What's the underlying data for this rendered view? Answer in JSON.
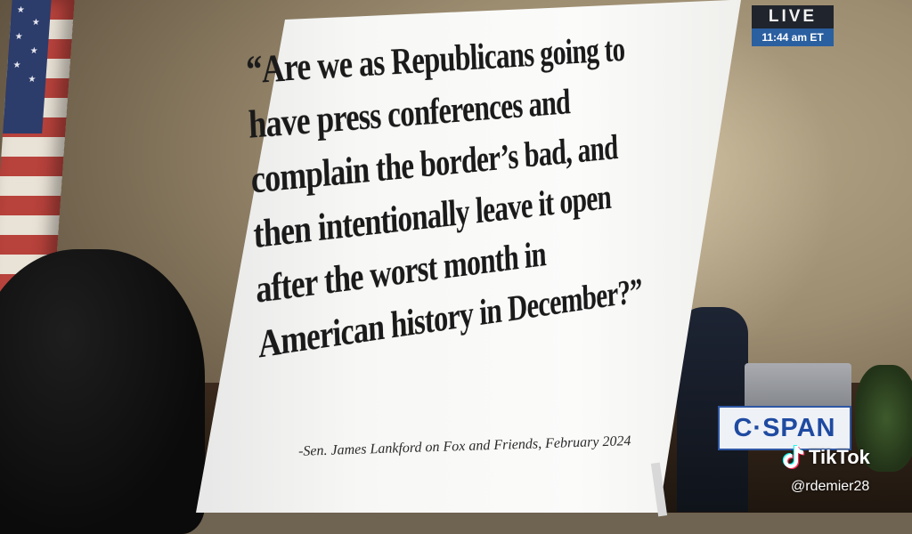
{
  "board": {
    "quote_lines": [
      "“Are we as Republicans going to",
      "have press conferences and",
      "complain the border’s bad, and",
      "then intentionally leave it open",
      "after the worst month in",
      "American history in December?”"
    ],
    "attribution": "-Sen. James Lankford on Fox and Friends, February 2024"
  },
  "overlay": {
    "live_label": "LIVE",
    "live_time": "11:44 am ET",
    "network_logo": "C·SPAN",
    "tiktok_label": "TikTok",
    "tiktok_icon": "tiktok-logo-icon",
    "handle": "@rdemier28"
  },
  "colors": {
    "cspan_blue": "#1e4aa1",
    "live_blue": "#2a5fa0"
  }
}
